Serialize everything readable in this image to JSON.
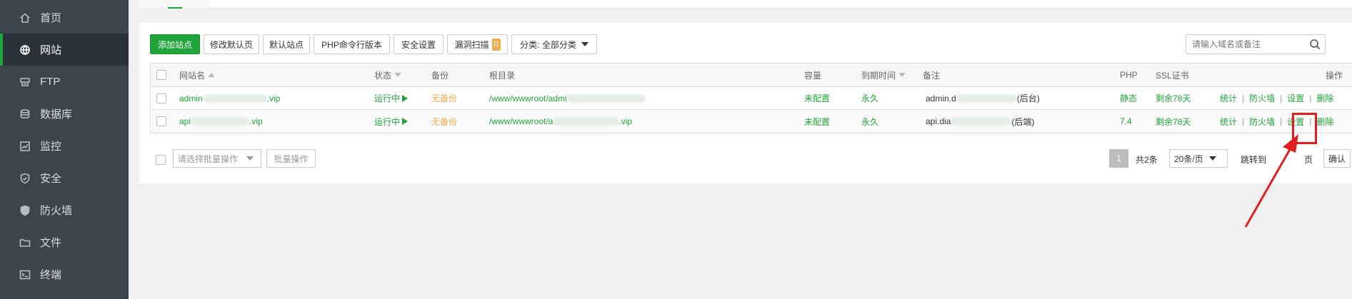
{
  "sidebar": {
    "items": [
      {
        "label": "首页",
        "icon": "home-icon"
      },
      {
        "label": "网站",
        "icon": "globe-icon"
      },
      {
        "label": "FTP",
        "icon": "ftp-icon"
      },
      {
        "label": "数据库",
        "icon": "database-icon"
      },
      {
        "label": "监控",
        "icon": "monitor-icon"
      },
      {
        "label": "安全",
        "icon": "shield-icon"
      },
      {
        "label": "防火墙",
        "icon": "firewall-icon"
      },
      {
        "label": "文件",
        "icon": "folder-icon"
      },
      {
        "label": "终端",
        "icon": "terminal-icon"
      }
    ],
    "active": "网站"
  },
  "toolbar": {
    "add_site": "添加站点",
    "edit_default_page": "修改默认页",
    "default_site": "默认站点",
    "php_cli_version": "PHP命令行版本",
    "security_settings": "安全设置",
    "vuln_scan": "漏洞扫描",
    "vuln_count": "0",
    "category": "分类: 全部分类"
  },
  "search": {
    "placeholder": "请输入域名或备注"
  },
  "table": {
    "headers": {
      "name": "网站名",
      "status": "状态",
      "backup": "备份",
      "root": "根目录",
      "quota": "容量",
      "expire": "到期时间",
      "note": "备注",
      "php": "PHP",
      "ssl": "SSL证书",
      "actions": "操作"
    },
    "rows": [
      {
        "name_prefix": "admin",
        "name_suffix": ".vip",
        "status": "运行中",
        "backup": "无备份",
        "root_prefix": "/www/wwwroot/admi",
        "root_suffix": "",
        "quota": "未配置",
        "expire": "永久",
        "note_prefix": "admin.d",
        "note_suffix": "(后台)",
        "php": "静态",
        "ssl": "剩余78天",
        "act_stats": "统计",
        "act_firewall": "防火墙",
        "act_settings": "设置",
        "act_delete": "删除"
      },
      {
        "name_prefix": "api",
        "name_suffix": ".vip",
        "status": "运行中",
        "backup": "无备份",
        "root_prefix": "/www/wwwroot/a",
        "root_suffix": ".vip",
        "quota": "未配置",
        "expire": "永久",
        "note_prefix": "api.dia",
        "note_suffix": "(后端)",
        "php": "7.4",
        "ssl": "剩余78天",
        "act_stats": "统计",
        "act_firewall": "防火墙",
        "act_settings": "设置",
        "act_delete": "删除"
      }
    ]
  },
  "footer": {
    "batch_select": "请选择批量操作",
    "batch_button": "批量操作",
    "current_page": "1",
    "total": "共2条",
    "page_size": "20条/页",
    "jump_to": "跳转到",
    "page_unit": "页",
    "confirm": "确认"
  },
  "colors": {
    "accent": "#20a53a",
    "warning": "#f0ad4e",
    "sidebar_bg": "#3c444d",
    "annotation": "#e02020"
  }
}
